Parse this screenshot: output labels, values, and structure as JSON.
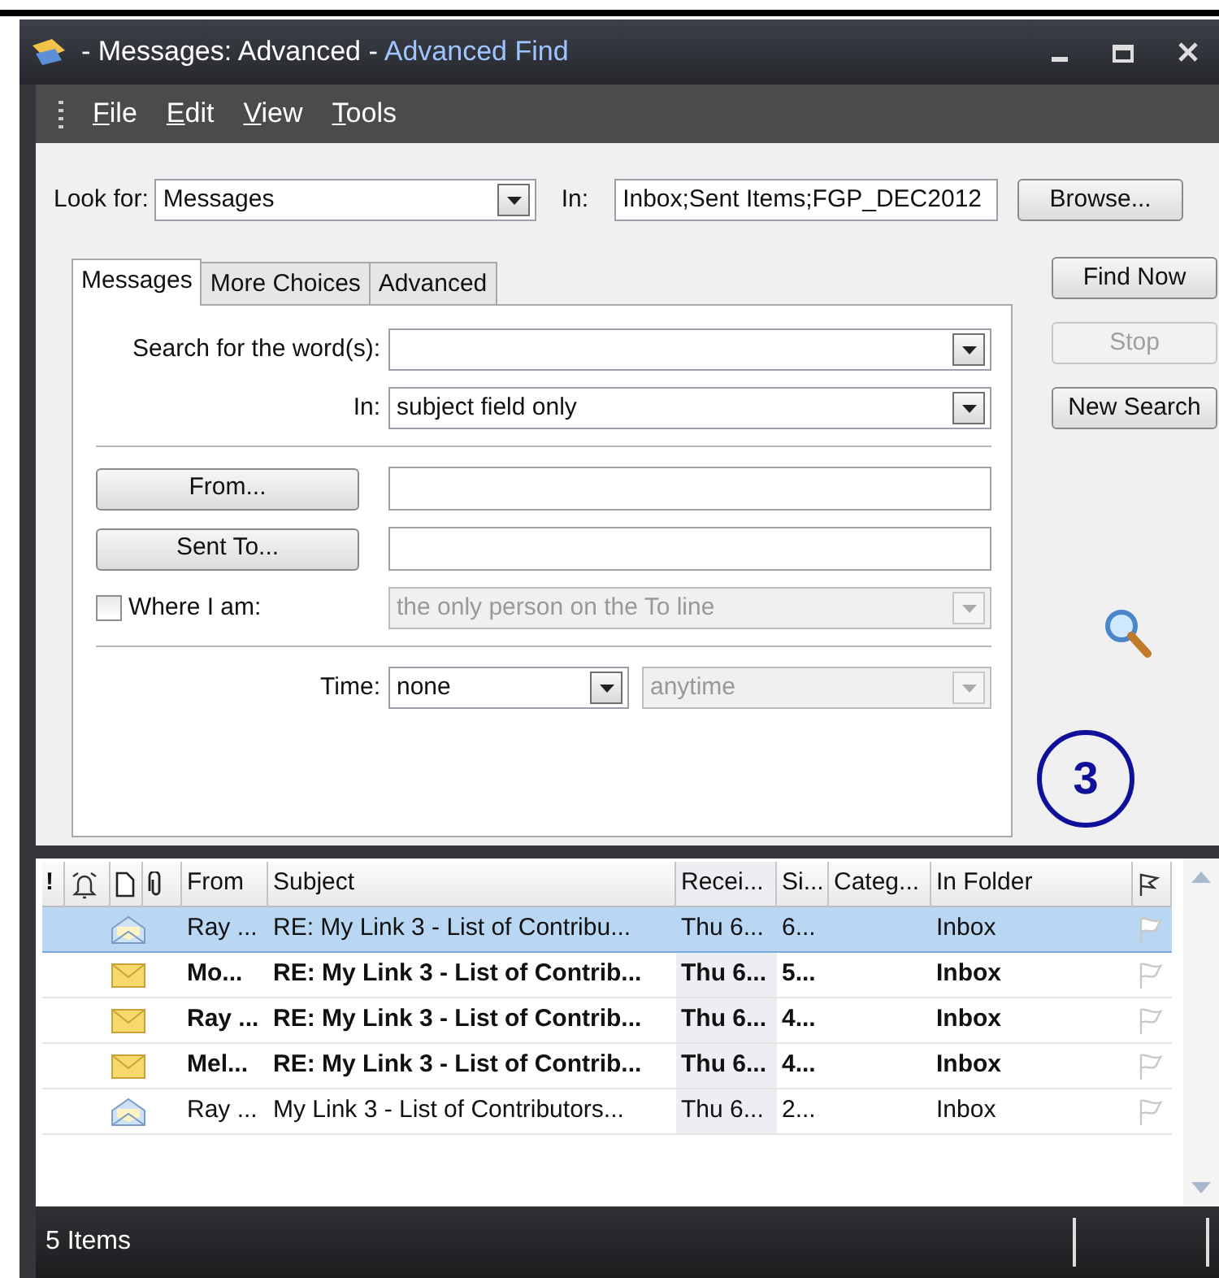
{
  "window": {
    "title_prefix": "- Messages: Advanced -",
    "app_name": "Advanced Find"
  },
  "menu": [
    "File",
    "Edit",
    "View",
    "Tools"
  ],
  "look_for": {
    "label": "Look for:",
    "value": "Messages",
    "in_label": "In:",
    "in_value": "Inbox;Sent Items;FGP_DEC2012",
    "browse": "Browse..."
  },
  "tabs": [
    {
      "label": "Messages",
      "selected": true
    },
    {
      "label": "More Choices",
      "selected": false
    },
    {
      "label": "Advanced",
      "selected": false
    }
  ],
  "form": {
    "words": {
      "label": "Search for the word(s):"
    },
    "in": {
      "label": "In:",
      "value": "subject field only"
    },
    "from": {
      "button": "From..."
    },
    "sent_to": {
      "button": "Sent To..."
    },
    "where": {
      "label": "Where I am:",
      "checked": false,
      "value": "the only person on the To line",
      "disabled": true
    },
    "time": {
      "label": "Time:",
      "value": "none",
      "range": "anytime",
      "range_disabled": true
    }
  },
  "actions": [
    {
      "label": "Find Now",
      "disabled": false
    },
    {
      "label": "Stop",
      "disabled": true
    },
    {
      "label": "New Search",
      "disabled": false
    }
  ],
  "annotation": "3",
  "results": {
    "columns": [
      "!",
      "From",
      "Subject",
      "Recei...",
      "Si...",
      "Categ...",
      "In Folder"
    ],
    "rows": [
      {
        "from": "Ray ...",
        "subject": "RE: My Link 3 - List of Contribu...",
        "received": "Thu 6...",
        "size": "6...",
        "folder": "Inbox",
        "read": true,
        "selected": true
      },
      {
        "from": "Mo...",
        "subject": "RE: My Link 3 - List of Contrib...",
        "received": "Thu 6...",
        "size": "5...",
        "folder": "Inbox",
        "read": false,
        "selected": false
      },
      {
        "from": "Ray ...",
        "subject": "RE: My Link 3 - List of Contrib...",
        "received": "Thu 6...",
        "size": "4...",
        "folder": "Inbox",
        "read": false,
        "selected": false
      },
      {
        "from": "Mel...",
        "subject": "RE: My Link 3 - List of Contrib...",
        "received": "Thu 6...",
        "size": "4...",
        "folder": "Inbox",
        "read": false,
        "selected": false
      },
      {
        "from": "Ray ...",
        "subject": "My Link 3 - List of Contributors...",
        "received": "Thu 6...",
        "size": "2...",
        "folder": "Inbox",
        "read": true,
        "selected": false
      }
    ]
  },
  "status_bar": {
    "text": "5 Items"
  }
}
